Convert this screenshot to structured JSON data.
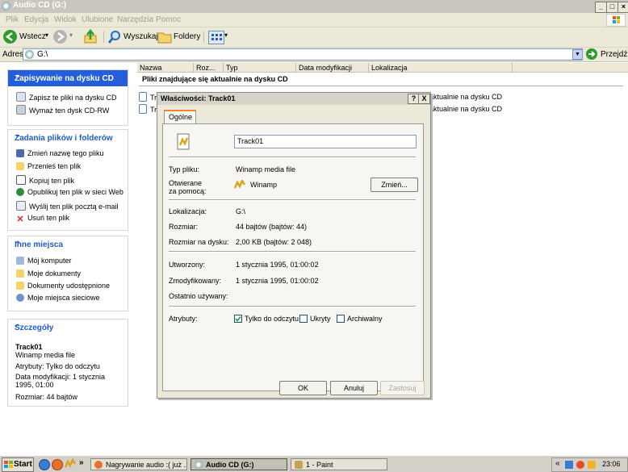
{
  "window": {
    "title": "Audio CD (G:)"
  },
  "menu": [
    "Plik",
    "Edycja",
    "Widok",
    "Ulubione",
    "Narzędzia",
    "Pomoc"
  ],
  "toolbar": {
    "back": "Wstecz",
    "search": "Wyszukaj",
    "folders": "Foldery"
  },
  "address": {
    "label": "Adres",
    "value": "G:\\",
    "go": "Przejdź"
  },
  "left_panes": {
    "burn": {
      "title": "Zapisywanie na dysku CD",
      "items": [
        "Zapisz te pliki na dysku CD",
        "Wymaż ten dysk CD-RW"
      ]
    },
    "tasks": {
      "title": "Zadania plików i folderów",
      "items": [
        "Zmień nazwę tego pliku",
        "Przenieś ten plik",
        "Kopiuj ten plik",
        "Opublikuj ten plik w sieci Web",
        "Wyślij ten plik pocztą e-mail",
        "Usuń ten plik"
      ]
    },
    "places": {
      "title": "Inne miejsca",
      "items": [
        "Mój komputer",
        "Moje dokumenty",
        "Dokumenty udostępnione",
        "Moje miejsca sieciowe"
      ]
    },
    "details": {
      "title": "Szczegóły",
      "name": "Track01",
      "type": "Winamp media file",
      "attributes": "Atrybuty: Tylko do odczytu",
      "modified": "Data modyfikacji: 1 stycznia 1995, 01:00",
      "size": "Rozmiar: 44 bajtów"
    }
  },
  "list": {
    "columns": [
      "Nazwa",
      "Roz...",
      "Typ",
      "Data modyfikacji",
      "Lokalizacja"
    ],
    "group_header": "Pliki znajdujące się aktualnie na dysku CD",
    "rows": [
      {
        "name": "Tra",
        "location": "aktualnie na dysku CD"
      },
      {
        "name": "Tra",
        "location": "aktualnie na dysku CD"
      }
    ]
  },
  "dialog": {
    "title": "Właściwości: Track01",
    "help": "?",
    "close": "X",
    "tab": "Ogólne",
    "filename": "Track01",
    "type_label": "Typ pliku:",
    "type_value": "Winamp media file",
    "opens_label_1": "Otwierane",
    "opens_label_2": "za pomocą:",
    "opens_value": "Winamp",
    "change": "Zmień...",
    "location_label": "Lokalizacja:",
    "location_value": "G:\\",
    "size_label": "Rozmiar:",
    "size_value": "44 bajtów (bajtów: 44)",
    "disk_size_label": "Rozmiar na dysku:",
    "disk_size_value": "2,00 KB (bajtów: 2 048)",
    "created_label": "Utworzony:",
    "created_value": "1 stycznia 1995, 01:00:02",
    "modified_label": "Zmodyfikowany:",
    "modified_value": "1 stycznia 1995, 01:00:02",
    "accessed_label": "Ostatnio używany:",
    "attributes_label": "Atrybuty:",
    "readonly": "Tylko do odczytu",
    "hidden": "Ukryty",
    "archive": "Archiwalny",
    "ok": "OK",
    "cancel": "Anuluj",
    "apply": "Zastosuj"
  },
  "taskbar": {
    "start": "Start",
    "chevron": "»",
    "items": [
      "Nagrywanie audio :( już ...",
      "Audio CD (G:)",
      "1 - Paint"
    ],
    "tray_chevron": "«",
    "clock": "23:06"
  },
  "colors": {
    "pane_header": "#c6d3f7",
    "pane_header_text": "#215dc6",
    "dialog_bg": "#ece9d8",
    "taskbar": "#d4d0c8"
  }
}
